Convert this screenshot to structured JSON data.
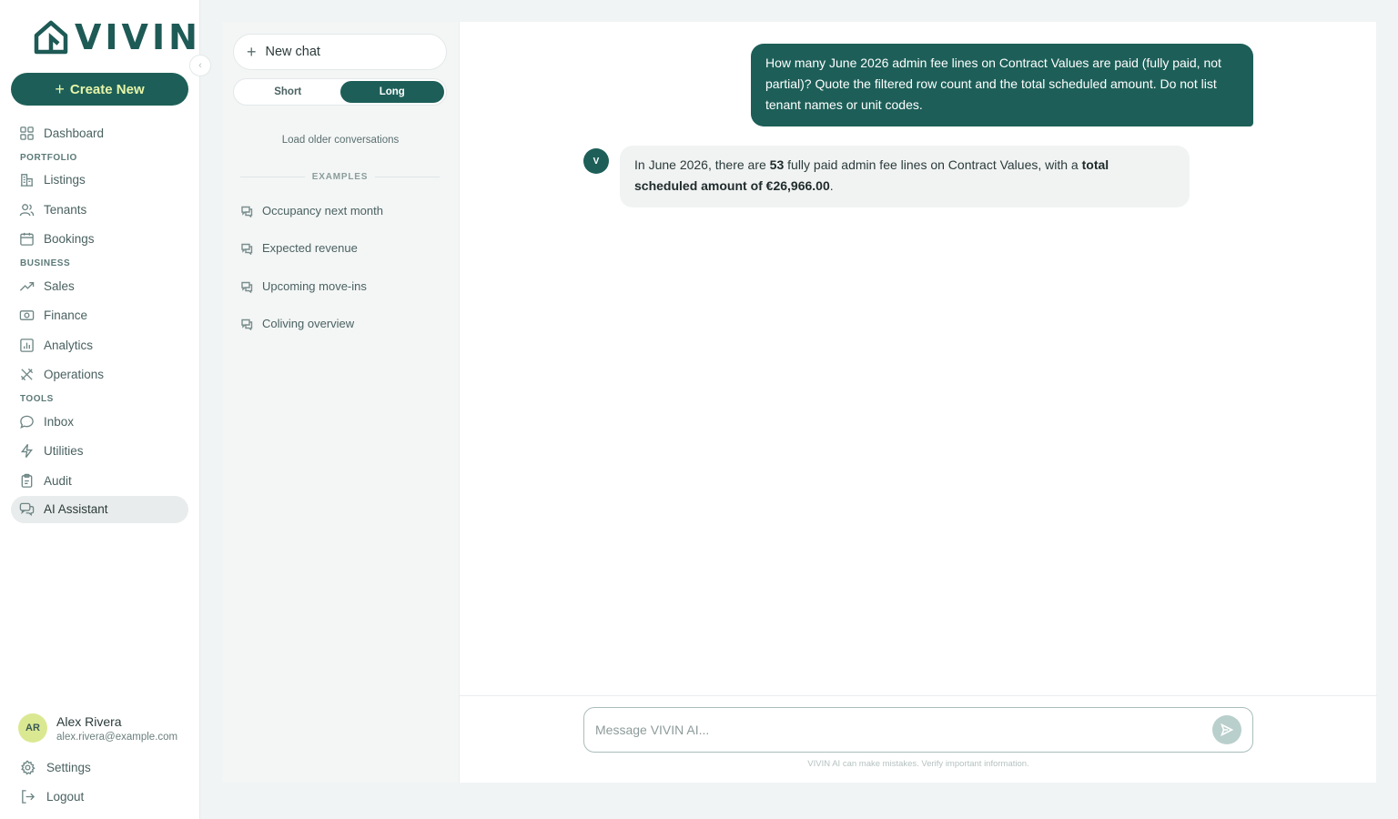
{
  "brand": {
    "logo_text": "VIVIN"
  },
  "nav": {
    "create_label": "Create New",
    "items": [
      {
        "label": "Dashboard",
        "icon": "grid-icon"
      },
      {
        "section": "PORTFOLIO"
      },
      {
        "label": "Listings",
        "icon": "building-icon"
      },
      {
        "label": "Tenants",
        "icon": "users-icon"
      },
      {
        "label": "Bookings",
        "icon": "calendar-icon"
      },
      {
        "section": "BUSINESS"
      },
      {
        "label": "Sales",
        "icon": "trending-up-icon"
      },
      {
        "label": "Finance",
        "icon": "banknote-icon"
      },
      {
        "label": "Analytics",
        "icon": "bar-chart-icon"
      },
      {
        "label": "Operations",
        "icon": "tools-icon"
      },
      {
        "section": "TOOLS"
      },
      {
        "label": "Inbox",
        "icon": "message-circle-icon"
      },
      {
        "label": "Utilities",
        "icon": "zap-icon"
      },
      {
        "label": "Audit",
        "icon": "clipboard-icon"
      },
      {
        "label": "AI Assistant",
        "icon": "chat-bubbles-icon",
        "active": true
      }
    ]
  },
  "user": {
    "initials": "AR",
    "name": "Alex Rivera",
    "email": "alex.rivera@example.com"
  },
  "footer": {
    "settings_label": "Settings",
    "logout_label": "Logout"
  },
  "conversations": {
    "new_chat_label": "New chat",
    "length_options": [
      "Short",
      "Long"
    ],
    "selected_length": "Long",
    "load_older_label": "Load older conversations",
    "examples_heading": "EXAMPLES",
    "examples": [
      "Occupancy next month",
      "Expected revenue",
      "Upcoming move-ins",
      "Coliving overview"
    ]
  },
  "chat": {
    "user_message": "How many June 2026 admin fee lines on Contract Values are paid (fully paid, not partial)? Quote the filtered row count and the total scheduled amount. Do not list tenant names or unit codes.",
    "bot_avatar": "V",
    "bot_message": {
      "part1": "In June 2026, there are ",
      "count": "53",
      "part2": " fully paid admin fee lines on Contract Values, with a ",
      "total_label": "total scheduled amount of €26,966.00",
      "part3": "."
    },
    "input_placeholder": "Message VIVIN AI...",
    "disclaimer": "VIVIN AI can make mistakes. Verify important information."
  },
  "colors": {
    "brand": "#1d5f58",
    "accent": "#e7f5a9",
    "avatar_bg": "#dbe892"
  }
}
